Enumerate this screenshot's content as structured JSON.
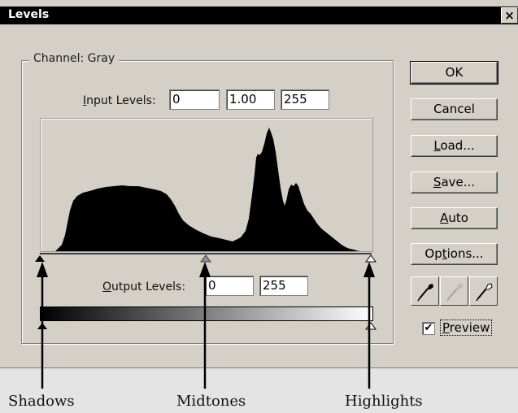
{
  "window": {
    "title": "Levels",
    "close_glyph": "×"
  },
  "channel": {
    "label": "Channel:",
    "value": "Gray"
  },
  "input_levels": {
    "label_mnemonic": "I",
    "label_rest": "nput Levels:",
    "shadow": "0",
    "midtone": "1.00",
    "highlight": "255"
  },
  "output_levels": {
    "label_mnemonic": "O",
    "label_rest": "utput Levels:",
    "shadow": "0",
    "highlight": "255"
  },
  "buttons": {
    "ok": "OK",
    "cancel": "Cancel",
    "load_mnemonic": "L",
    "load_rest": "oad...",
    "save_mnemonic": "S",
    "save_rest": "ave...",
    "auto_mnemonic": "A",
    "auto_rest": "uto",
    "options_pre": "Op",
    "options_mnemonic": "t",
    "options_rest": "ions..."
  },
  "eyedroppers": [
    "black-point-eyedropper-icon",
    "gray-point-eyedropper-icon",
    "white-point-eyedropper-icon"
  ],
  "preview": {
    "checked": true,
    "check_glyph": "✔",
    "mnemonic": "P",
    "rest": "review"
  },
  "callouts": {
    "shadows": "Shadows",
    "midtones": "Midtones",
    "highlights": "Highlights"
  },
  "histogram": {
    "profile": [
      [
        0,
        0
      ],
      [
        18,
        0
      ],
      [
        20,
        2
      ],
      [
        26,
        8
      ],
      [
        30,
        20
      ],
      [
        33,
        35
      ],
      [
        36,
        50
      ],
      [
        40,
        62
      ],
      [
        45,
        68
      ],
      [
        52,
        72
      ],
      [
        60,
        74
      ],
      [
        70,
        77
      ],
      [
        80,
        79
      ],
      [
        90,
        80
      ],
      [
        100,
        81
      ],
      [
        110,
        80
      ],
      [
        120,
        80
      ],
      [
        130,
        78
      ],
      [
        140,
        76
      ],
      [
        148,
        74
      ],
      [
        155,
        70
      ],
      [
        160,
        64
      ],
      [
        165,
        56
      ],
      [
        170,
        46
      ],
      [
        175,
        38
      ],
      [
        182,
        32
      ],
      [
        190,
        27
      ],
      [
        200,
        22
      ],
      [
        210,
        18
      ],
      [
        220,
        16
      ],
      [
        228,
        14
      ],
      [
        232,
        13
      ],
      [
        236,
        12
      ],
      [
        240,
        14
      ],
      [
        246,
        17
      ],
      [
        252,
        25
      ],
      [
        256,
        40
      ],
      [
        260,
        70
      ],
      [
        263,
        95
      ],
      [
        265,
        115
      ],
      [
        267,
        120
      ],
      [
        269,
        118
      ],
      [
        272,
        122
      ],
      [
        275,
        132
      ],
      [
        278,
        145
      ],
      [
        281,
        152
      ],
      [
        283,
        147
      ],
      [
        286,
        138
      ],
      [
        289,
        122
      ],
      [
        292,
        100
      ],
      [
        295,
        78
      ],
      [
        298,
        62
      ],
      [
        300,
        56
      ],
      [
        302,
        62
      ],
      [
        305,
        76
      ],
      [
        308,
        82
      ],
      [
        311,
        80
      ],
      [
        314,
        84
      ],
      [
        317,
        80
      ],
      [
        320,
        70
      ],
      [
        324,
        58
      ],
      [
        328,
        50
      ],
      [
        332,
        46
      ],
      [
        336,
        40
      ],
      [
        340,
        34
      ],
      [
        345,
        28
      ],
      [
        350,
        24
      ],
      [
        355,
        20
      ],
      [
        360,
        16
      ],
      [
        365,
        12
      ],
      [
        370,
        8
      ],
      [
        375,
        5
      ],
      [
        380,
        3
      ],
      [
        385,
        2
      ],
      [
        388,
        1
      ],
      [
        393,
        0
      ],
      [
        408,
        0
      ]
    ]
  },
  "colors": {
    "dialog_bg": "#d4d0c8",
    "titlebar_bg": "#000000",
    "histogram_fill": "#000000"
  }
}
